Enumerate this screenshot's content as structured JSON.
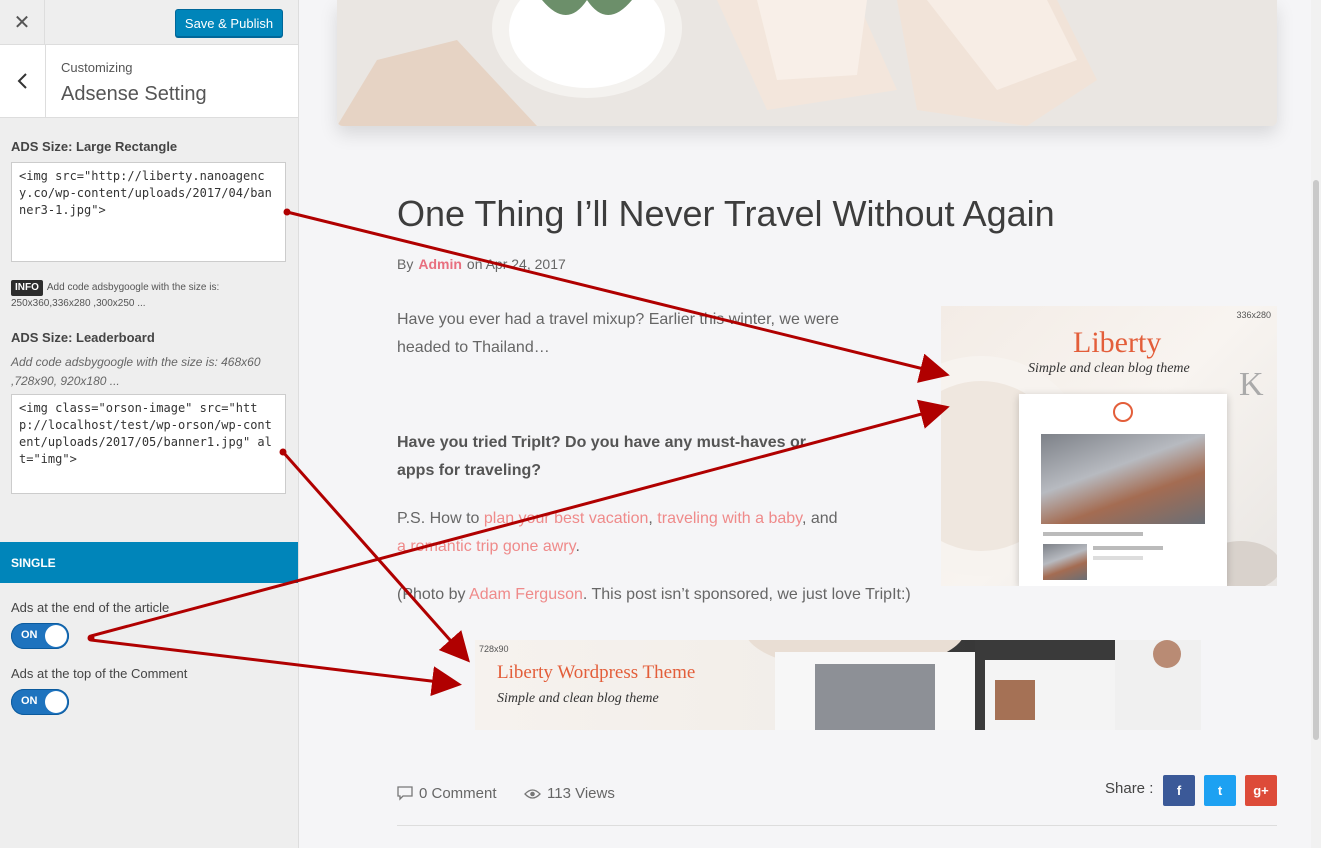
{
  "sidebar": {
    "close_label": "✕",
    "publish_label": "Save & Publish",
    "customizing_label": "Customizing",
    "panel_title": "Adsense Setting",
    "large_rectangle": {
      "label": "ADS Size: Large Rectangle",
      "code": "<img src=\"http://liberty.nanoagency.co/wp-content/uploads/2017/04/banner3-1.jpg\">",
      "info_badge": "INFO",
      "info_text": "Add code adsbygoogle with the size is: 250x360,336x280 ,300x250 ..."
    },
    "leaderboard": {
      "label": "ADS Size: Leaderboard",
      "description": "Add code adsbygoogle with the size is: 468x60 ,728x90, 920x180 ...",
      "code": "<img class=\"orson-image\" src=\"http://localhost/test/wp-orson/wp-content/uploads/2017/05/banner1.jpg\" alt=\"img\">"
    },
    "section_title": "SINGLE",
    "toggles": [
      {
        "label": "Ads at the end of the article",
        "state": "ON"
      },
      {
        "label": "Ads at the top of the Comment",
        "state": "ON"
      }
    ]
  },
  "post": {
    "title": "One Thing I’ll Never Travel Without Again",
    "by": "By",
    "author": "Admin",
    "date": "on Apr 24, 2017",
    "intro": "Have you ever had a travel mixup? Earlier this winter, we were headed to Thailand…",
    "question": "Have you tried TripIt? Do you have any must-haves or apps for traveling?",
    "ps_prefix": "P.S. How to ",
    "ps_link1": "plan your best vacation",
    "ps_sep1": ", ",
    "ps_link2": "traveling with a baby",
    "ps_sep2": ", and ",
    "ps_link3": "a romantic trip gone awry",
    "ps_end": ".",
    "photo_prefix": "(Photo by ",
    "photo_link": "Adam Ferguson",
    "photo_suffix": ". This post isn’t sponsored, we just love TripIt:)"
  },
  "ads": {
    "side": {
      "size": "336x280",
      "title": "Liberty",
      "subtitle": "Simple and clean blog theme",
      "deco_letter": "K"
    },
    "leader": {
      "size": "728x90",
      "title": "Liberty Wordpress Theme",
      "subtitle": "Simple and clean blog theme"
    }
  },
  "footer": {
    "comments": "0 Comment",
    "views": "113 Views",
    "share_label": "Share :",
    "share_facebook": "f",
    "share_twitter": "t",
    "share_google": "g+"
  },
  "colors": {
    "primary": "#0085ba",
    "toggle_on": "#1e73be",
    "link": "#ef8a8a",
    "arrow": "#b00000",
    "facebook": "#3b5998",
    "twitter": "#1da1f2",
    "google": "#dd4b39"
  }
}
